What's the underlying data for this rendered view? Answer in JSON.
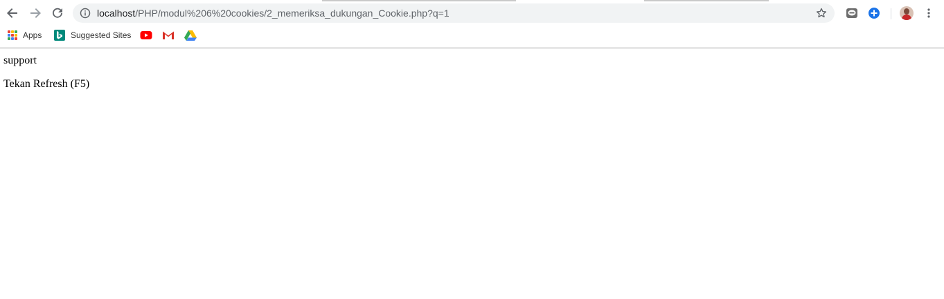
{
  "address_bar": {
    "url_host": "localhost",
    "url_path": "/PHP/modul%206%20cookies/2_memeriksa_dukungan_Cookie.php?q=1"
  },
  "bookmarks": [
    {
      "label": "Apps",
      "icon": "apps-grid-icon"
    },
    {
      "label": "Suggested Sites",
      "icon": "bing-icon"
    },
    {
      "label": "",
      "icon": "youtube-icon"
    },
    {
      "label": "",
      "icon": "gmail-icon"
    },
    {
      "label": "",
      "icon": "google-drive-icon"
    }
  ],
  "toolbar_icons": {
    "back": "back-arrow-icon",
    "forward": "forward-arrow-icon",
    "reload": "reload-icon",
    "info": "info-icon",
    "star": "star-icon",
    "extension_1": "line-chat-icon",
    "extension_2": "plus-icon",
    "profile": "avatar",
    "menu": "more-vert-icon"
  },
  "colors": {
    "omnibox_bg": "#f1f3f4",
    "youtube_red": "#ff0000",
    "gmail_red": "#d93025",
    "plus_blue": "#1a73e8",
    "bing_teal": "#00897b"
  },
  "page": {
    "line1": "support",
    "line2": "Tekan Refresh (F5)"
  }
}
